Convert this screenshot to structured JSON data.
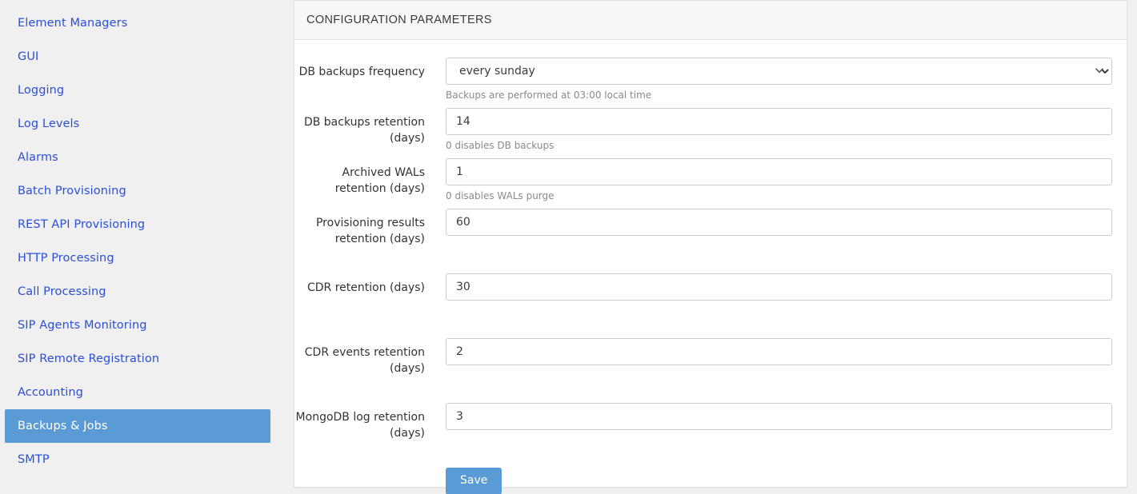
{
  "sidebar": {
    "items": [
      {
        "label": "Element Managers",
        "active": false
      },
      {
        "label": "GUI",
        "active": false
      },
      {
        "label": "Logging",
        "active": false
      },
      {
        "label": "Log Levels",
        "active": false
      },
      {
        "label": "Alarms",
        "active": false
      },
      {
        "label": "Batch Provisioning",
        "active": false
      },
      {
        "label": "REST API Provisioning",
        "active": false
      },
      {
        "label": "HTTP Processing",
        "active": false
      },
      {
        "label": "Call Processing",
        "active": false
      },
      {
        "label": "SIP Agents Monitoring",
        "active": false
      },
      {
        "label": "SIP Remote Registration",
        "active": false
      },
      {
        "label": "Accounting",
        "active": false
      },
      {
        "label": "Backups & Jobs",
        "active": true
      },
      {
        "label": "SMTP",
        "active": false
      }
    ]
  },
  "panel": {
    "title": "CONFIGURATION PARAMETERS"
  },
  "form": {
    "fields": [
      {
        "label": "DB backups frequency",
        "type": "select",
        "value": "every sunday",
        "options": [
          "every sunday"
        ],
        "help": "Backups are performed at 03:00 local time",
        "name": "db-backups-frequency"
      },
      {
        "label": "DB backups retention (days)",
        "type": "text",
        "value": "14",
        "help": "0 disables DB backups",
        "name": "db-backups-retention"
      },
      {
        "label": "Archived WALs retention (days)",
        "type": "text",
        "value": "1",
        "help": "0 disables WALs purge",
        "name": "archived-wals-retention"
      },
      {
        "label": "Provisioning results retention (days)",
        "type": "text",
        "value": "60",
        "help": "",
        "name": "provisioning-results-retention"
      },
      {
        "label": "CDR retention (days)",
        "type": "text",
        "value": "30",
        "help": "",
        "name": "cdr-retention"
      },
      {
        "label": "CDR events retention (days)",
        "type": "text",
        "value": "2",
        "help": "",
        "name": "cdr-events-retention"
      },
      {
        "label": "MongoDB log retention (days)",
        "type": "text",
        "value": "3",
        "help": "",
        "name": "mongodb-log-retention"
      }
    ],
    "save_label": "Save",
    "chevron_icon": "chevron-down-icon"
  },
  "colors": {
    "accent": "#5b9bd5",
    "link": "#2b4fd8",
    "page_background": "#f0f0f0",
    "panel_background": "#ffffff",
    "panel_header_background": "#f7f7f7",
    "help_text": "#8a8a8a"
  }
}
